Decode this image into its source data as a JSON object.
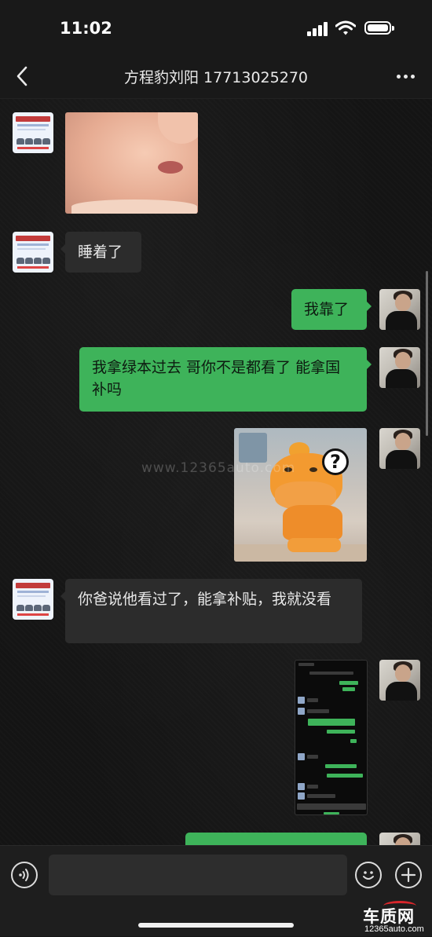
{
  "status_bar": {
    "time": "11:02",
    "icons": [
      "signal-icon",
      "wifi-icon",
      "battery-icon"
    ]
  },
  "nav": {
    "back_icon": "chevron-left-icon",
    "title": "方程豹刘阳 17713025270",
    "more_icon": "more-dots-icon"
  },
  "messages": [
    {
      "id": 1,
      "from": "contact",
      "type": "image",
      "content": "crying-baby-sticker"
    },
    {
      "id": 2,
      "from": "contact",
      "type": "text",
      "text": "睡着了"
    },
    {
      "id": 3,
      "from": "me",
      "type": "text",
      "text": "我靠了"
    },
    {
      "id": 4,
      "from": "me",
      "type": "text",
      "text": "我拿绿本过去 哥你不是都看了 能拿国补吗"
    },
    {
      "id": 5,
      "from": "me",
      "type": "image",
      "content": "confused-hippo-sticker"
    },
    {
      "id": 6,
      "from": "contact",
      "type": "text",
      "text": "你爸说他看过了，能拿补贴，我就没看"
    },
    {
      "id": 7,
      "from": "me",
      "type": "image",
      "content": "chat-screenshot"
    },
    {
      "id": 8,
      "from": "me",
      "type": "text",
      "text": ""
    }
  ],
  "watermark": "www.12365auto.com",
  "input_bar": {
    "voice_icon": "voice-icon",
    "input_value": "",
    "emoji_icon": "emoji-icon",
    "plus_icon": "plus-icon"
  },
  "logo": {
    "brand": "车质网",
    "url": "12365auto.com"
  },
  "colors": {
    "bubble_out": "#3eb35a",
    "bubble_in": "#2c2c2c",
    "background": "#141414",
    "logo_accent": "#d8262b"
  }
}
